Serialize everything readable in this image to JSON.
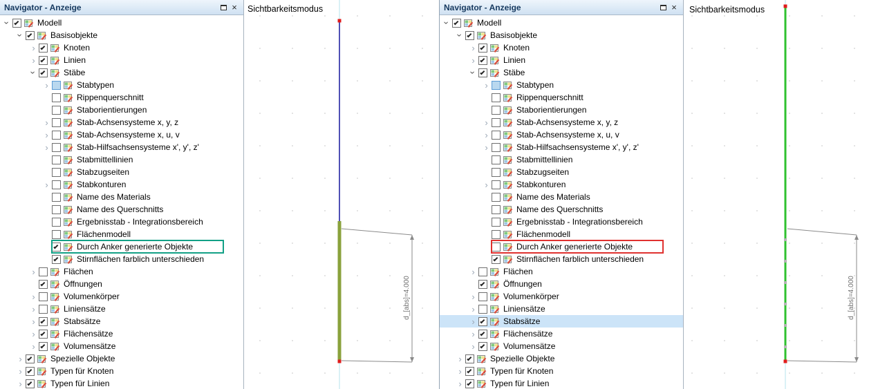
{
  "panels": [
    {
      "side": "left",
      "navigator": {
        "title": "Navigator - Anzeige",
        "close_icon": "×"
      },
      "viewport": {
        "title": "Sichtbarkeitsmodus",
        "dimension_label": "d_[abs]=4.000"
      }
    },
    {
      "side": "right",
      "navigator": {
        "title": "Navigator - Anzeige",
        "close_icon": "×"
      },
      "viewport": {
        "title": "Sichtbarkeitsmodus",
        "dimension_label": "d_[abs]=4.000"
      }
    }
  ],
  "colors": {
    "member_blue": "#4f51b5",
    "member_olive": "#8aa23c",
    "member_green": "#2fc12f",
    "node_red": "#e01b1b",
    "axis_cyan": "#b5e3ee",
    "highlight_green": "#12a086",
    "highlight_red": "#e0312f",
    "selection_blue": "#cce4f8"
  },
  "tree": {
    "items": [
      {
        "label": "Modell",
        "level": 0,
        "arrow": "expanded",
        "left": {
          "check": "checked"
        },
        "right": {
          "check": "checked"
        }
      },
      {
        "label": "Basisobjekte",
        "level": 1,
        "arrow": "expanded",
        "left": {
          "check": "checked"
        },
        "right": {
          "check": "checked"
        }
      },
      {
        "label": "Knoten",
        "level": 2,
        "arrow": "collapsed",
        "left": {
          "check": "checked"
        },
        "right": {
          "check": "checked"
        }
      },
      {
        "label": "Linien",
        "level": 2,
        "arrow": "collapsed",
        "left": {
          "check": "checked"
        },
        "right": {
          "check": "checked"
        }
      },
      {
        "label": "Stäbe",
        "level": 2,
        "arrow": "expanded",
        "left": {
          "check": "checked"
        },
        "right": {
          "check": "checked"
        }
      },
      {
        "label": "Stabtypen",
        "level": 3,
        "arrow": "collapsed",
        "left": {
          "check": "partial"
        },
        "right": {
          "check": "partial"
        }
      },
      {
        "label": "Rippenquerschnitt",
        "level": 3,
        "arrow": "none",
        "left": {
          "check": "unchecked"
        },
        "right": {
          "check": "unchecked"
        }
      },
      {
        "label": "Staborientierungen",
        "level": 3,
        "arrow": "none",
        "left": {
          "check": "unchecked"
        },
        "right": {
          "check": "unchecked"
        }
      },
      {
        "label": "Stab-Achsensysteme x, y, z",
        "level": 3,
        "arrow": "collapsed",
        "left": {
          "check": "unchecked"
        },
        "right": {
          "check": "unchecked"
        }
      },
      {
        "label": "Stab-Achsensysteme x, u, v",
        "level": 3,
        "arrow": "collapsed",
        "left": {
          "check": "unchecked"
        },
        "right": {
          "check": "unchecked"
        }
      },
      {
        "label": "Stab-Hilfsachsensysteme x', y', z'",
        "level": 3,
        "arrow": "collapsed",
        "left": {
          "check": "unchecked"
        },
        "right": {
          "check": "unchecked"
        }
      },
      {
        "label": "Stabmittellinien",
        "level": 3,
        "arrow": "none",
        "left": {
          "check": "unchecked"
        },
        "right": {
          "check": "unchecked"
        }
      },
      {
        "label": "Stabzugseiten",
        "level": 3,
        "arrow": "none",
        "left": {
          "check": "unchecked"
        },
        "right": {
          "check": "unchecked"
        }
      },
      {
        "label": "Stabkonturen",
        "level": 3,
        "arrow": "collapsed",
        "left": {
          "check": "unchecked"
        },
        "right": {
          "check": "unchecked"
        }
      },
      {
        "label": "Name des Materials",
        "level": 3,
        "arrow": "none",
        "left": {
          "check": "unchecked"
        },
        "right": {
          "check": "unchecked"
        }
      },
      {
        "label": "Name des Querschnitts",
        "level": 3,
        "arrow": "none",
        "left": {
          "check": "unchecked"
        },
        "right": {
          "check": "unchecked"
        }
      },
      {
        "label": "Ergebnisstab - Integrationsbereich",
        "level": 3,
        "arrow": "none",
        "left": {
          "check": "unchecked"
        },
        "right": {
          "check": "unchecked"
        }
      },
      {
        "label": "Flächenmodell",
        "level": 3,
        "arrow": "none",
        "left": {
          "check": "unchecked"
        },
        "right": {
          "check": "unchecked"
        }
      },
      {
        "label": "Durch Anker generierte Objekte",
        "level": 3,
        "arrow": "none",
        "left": {
          "check": "checked",
          "highlight": "green"
        },
        "right": {
          "check": "unchecked",
          "highlight": "red"
        }
      },
      {
        "label": "Stirnflächen farblich unterschieden",
        "level": 3,
        "arrow": "none",
        "left": {
          "check": "checked"
        },
        "right": {
          "check": "checked"
        }
      },
      {
        "label": "Flächen",
        "level": 2,
        "arrow": "collapsed",
        "left": {
          "check": "unchecked"
        },
        "right": {
          "check": "unchecked"
        }
      },
      {
        "label": "Öffnungen",
        "level": 2,
        "arrow": "none",
        "left": {
          "check": "checked"
        },
        "right": {
          "check": "checked"
        }
      },
      {
        "label": "Volumenkörper",
        "level": 2,
        "arrow": "collapsed",
        "left": {
          "check": "unchecked"
        },
        "right": {
          "check": "unchecked"
        }
      },
      {
        "label": "Liniensätze",
        "level": 2,
        "arrow": "collapsed",
        "left": {
          "check": "unchecked"
        },
        "right": {
          "check": "unchecked"
        }
      },
      {
        "label": "Stabsätze",
        "level": 2,
        "arrow": "collapsed",
        "left": {
          "check": "checked"
        },
        "right": {
          "check": "checked",
          "selected": true
        }
      },
      {
        "label": "Flächensätze",
        "level": 2,
        "arrow": "collapsed",
        "left": {
          "check": "checked"
        },
        "right": {
          "check": "checked"
        }
      },
      {
        "label": "Volumensätze",
        "level": 2,
        "arrow": "collapsed",
        "left": {
          "check": "checked"
        },
        "right": {
          "check": "checked"
        }
      },
      {
        "label": "Spezielle Objekte",
        "level": 1,
        "arrow": "collapsed",
        "left": {
          "check": "checked"
        },
        "right": {
          "check": "checked"
        }
      },
      {
        "label": "Typen für Knoten",
        "level": 1,
        "arrow": "collapsed",
        "left": {
          "check": "checked"
        },
        "right": {
          "check": "checked"
        }
      },
      {
        "label": "Typen für Linien",
        "level": 1,
        "arrow": "collapsed",
        "left": {
          "check": "checked"
        },
        "right": {
          "check": "checked"
        }
      }
    ]
  }
}
